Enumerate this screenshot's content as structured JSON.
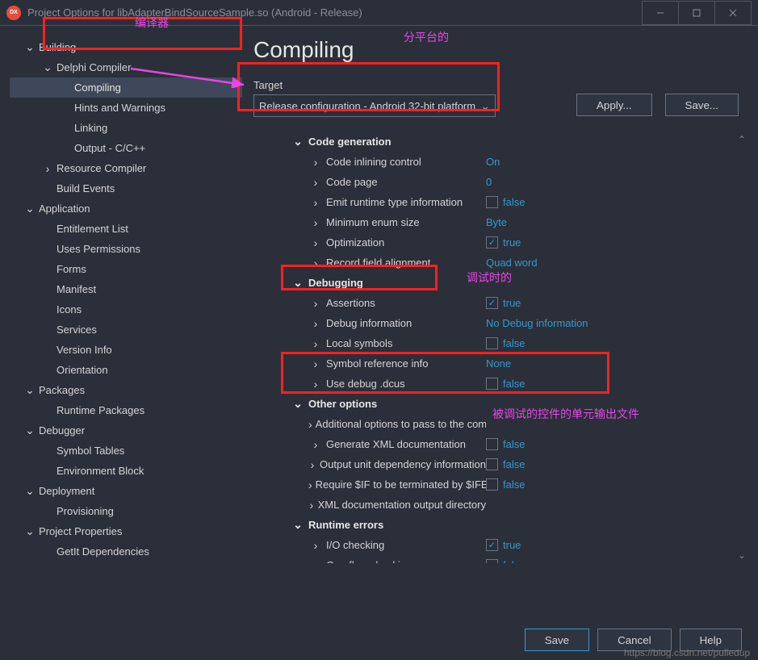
{
  "titlebar": {
    "dx": "DX",
    "title": "Project Options for libAdapterBindSourceSample.so  (Android - Release)"
  },
  "sidebar": [
    {
      "label": "Building",
      "lvl": 0,
      "open": true
    },
    {
      "label": "Delphi Compiler",
      "lvl": 1,
      "open": true
    },
    {
      "label": "Compiling",
      "lvl": 2,
      "selected": true
    },
    {
      "label": "Hints and Warnings",
      "lvl": 2
    },
    {
      "label": "Linking",
      "lvl": 2
    },
    {
      "label": "Output - C/C++",
      "lvl": 2
    },
    {
      "label": "Resource Compiler",
      "lvl": 1,
      "arrow": true
    },
    {
      "label": "Build Events",
      "lvl": 1
    },
    {
      "label": "Application",
      "lvl": 0,
      "open": true
    },
    {
      "label": "Entitlement List",
      "lvl": 1
    },
    {
      "label": "Uses Permissions",
      "lvl": 1
    },
    {
      "label": "Forms",
      "lvl": 1
    },
    {
      "label": "Manifest",
      "lvl": 1
    },
    {
      "label": "Icons",
      "lvl": 1
    },
    {
      "label": "Services",
      "lvl": 1
    },
    {
      "label": "Version Info",
      "lvl": 1
    },
    {
      "label": "Orientation",
      "lvl": 1
    },
    {
      "label": "Packages",
      "lvl": 0,
      "open": true
    },
    {
      "label": "Runtime Packages",
      "lvl": 1
    },
    {
      "label": "Debugger",
      "lvl": 0,
      "open": true
    },
    {
      "label": "Symbol Tables",
      "lvl": 1
    },
    {
      "label": "Environment Block",
      "lvl": 1
    },
    {
      "label": "Deployment",
      "lvl": 0,
      "open": true
    },
    {
      "label": "Provisioning",
      "lvl": 1
    },
    {
      "label": "Project Properties",
      "lvl": 0,
      "open": true
    },
    {
      "label": "GetIt Dependencies",
      "lvl": 1
    }
  ],
  "heading": "Compiling",
  "target": {
    "label": "Target",
    "value": "Release configuration - Android 32-bit platform"
  },
  "buttons": {
    "apply": "Apply...",
    "save": "Save..."
  },
  "sections": [
    {
      "type": "sect",
      "label": "Code generation",
      "open": true
    },
    {
      "type": "row",
      "label": "Code inlining control",
      "value": "On",
      "kind": "text"
    },
    {
      "type": "row",
      "label": "Code page",
      "value": "0",
      "kind": "text"
    },
    {
      "type": "row",
      "label": "Emit runtime type information",
      "value": "false",
      "kind": "check",
      "checked": false
    },
    {
      "type": "row",
      "label": "Minimum enum size",
      "value": "Byte",
      "kind": "text"
    },
    {
      "type": "row",
      "label": "Optimization",
      "value": "true",
      "kind": "check",
      "checked": true
    },
    {
      "type": "row",
      "label": "Record field alignment",
      "value": "Quad word",
      "kind": "text"
    },
    {
      "type": "sect",
      "label": "Debugging",
      "open": true
    },
    {
      "type": "row",
      "label": "Assertions",
      "value": "true",
      "kind": "check",
      "checked": true
    },
    {
      "type": "row",
      "label": "Debug information",
      "value": "No Debug information",
      "kind": "text"
    },
    {
      "type": "row",
      "label": "Local symbols",
      "value": "false",
      "kind": "check",
      "checked": false
    },
    {
      "type": "row",
      "label": "Symbol reference info",
      "value": "None",
      "kind": "text"
    },
    {
      "type": "row",
      "label": "Use debug .dcus",
      "value": "false",
      "kind": "check",
      "checked": false
    },
    {
      "type": "sect",
      "label": "Other options",
      "open": true
    },
    {
      "type": "row",
      "label": "Additional options to pass to the compiler",
      "value": "",
      "kind": "none"
    },
    {
      "type": "row",
      "label": "Generate XML documentation",
      "value": "false",
      "kind": "check",
      "checked": false
    },
    {
      "type": "row",
      "label": "Output unit dependency information",
      "value": "false",
      "kind": "check",
      "checked": false
    },
    {
      "type": "row",
      "label": "Require $IF to be terminated by $IFEND",
      "value": "false",
      "kind": "check",
      "checked": false
    },
    {
      "type": "row",
      "label": "XML documentation output directory",
      "value": "",
      "kind": "none"
    },
    {
      "type": "sect",
      "label": "Runtime errors",
      "open": true
    },
    {
      "type": "row",
      "label": "I/O checking",
      "value": "true",
      "kind": "check",
      "checked": true
    },
    {
      "type": "row",
      "label": "Overflow checking",
      "value": "false",
      "kind": "check",
      "checked": false
    }
  ],
  "footer": {
    "save": "Save",
    "cancel": "Cancel",
    "help": "Help"
  },
  "anno": {
    "a1": "编译器",
    "a2": "分平台的",
    "a3": "调试时的",
    "a4": "被调试的控件的单元输出文件"
  },
  "watermark": "https://blog.csdn.net/pulledup"
}
